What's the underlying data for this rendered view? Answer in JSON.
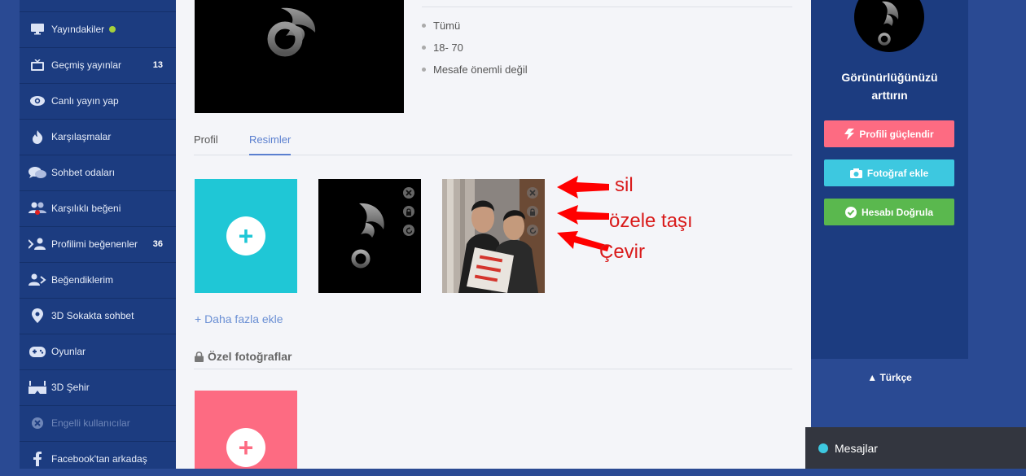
{
  "sidebar": {
    "items": [
      {
        "label": "Yayındakiler",
        "icon": "monitor-icon",
        "badge": "",
        "live": true
      },
      {
        "label": "Geçmiş yayınlar",
        "icon": "tv-icon",
        "badge": "13"
      },
      {
        "label": "Canlı yayın yap",
        "icon": "eye-icon",
        "badge": ""
      },
      {
        "label": "Karşılaşmalar",
        "icon": "flame-icon",
        "badge": ""
      },
      {
        "label": "Sohbet odaları",
        "icon": "chat-bubbles-icon",
        "badge": ""
      },
      {
        "label": "Karşılıklı beğeni",
        "icon": "mutual-users-icon",
        "badge": ""
      },
      {
        "label": "Profilimi beğenenler",
        "icon": "user-arrow-icon",
        "badge": "36"
      },
      {
        "label": "Beğendiklerim",
        "icon": "user-like-icon",
        "badge": ""
      },
      {
        "label": "3D Sokakta sohbet",
        "icon": "map-pin-icon",
        "badge": ""
      },
      {
        "label": "Oyunlar",
        "icon": "gamepad-icon",
        "badge": ""
      },
      {
        "label": "3D Şehir",
        "icon": "vr-glasses-icon",
        "badge": ""
      },
      {
        "label": "Engelli kullanıcılar",
        "icon": "block-icon",
        "badge": "",
        "disabled": true
      },
      {
        "label": "Facebook'tan arkadaş",
        "icon": "facebook-icon",
        "badge": ""
      }
    ]
  },
  "profile": {
    "info": [
      "Tümü",
      "18- 70",
      "Mesafe önemli değil"
    ]
  },
  "tabs": [
    {
      "label": "Profil",
      "active": false
    },
    {
      "label": "Resimler",
      "active": true
    }
  ],
  "photos": {
    "more_link": "+ Daha fazla ekle",
    "private_title": "Özel fotoğraflar"
  },
  "annotations": {
    "delete": "sil",
    "private": "özele taşı",
    "rotate": "Çevir"
  },
  "right_panel": {
    "promo_line1": "Görünürlüğünüzü",
    "promo_line2": "arttırın",
    "boost_label": "Profili güçlendir",
    "add_photo_label": "Fotoğraf ekle",
    "verify_label": "Hesabı Doğrula",
    "colors": {
      "boost": "#fd6b82",
      "add_photo": "#3dc8e0",
      "verify": "#5ab84e"
    }
  },
  "language": "Türkçe",
  "chat": {
    "label": "Mesajlar"
  }
}
